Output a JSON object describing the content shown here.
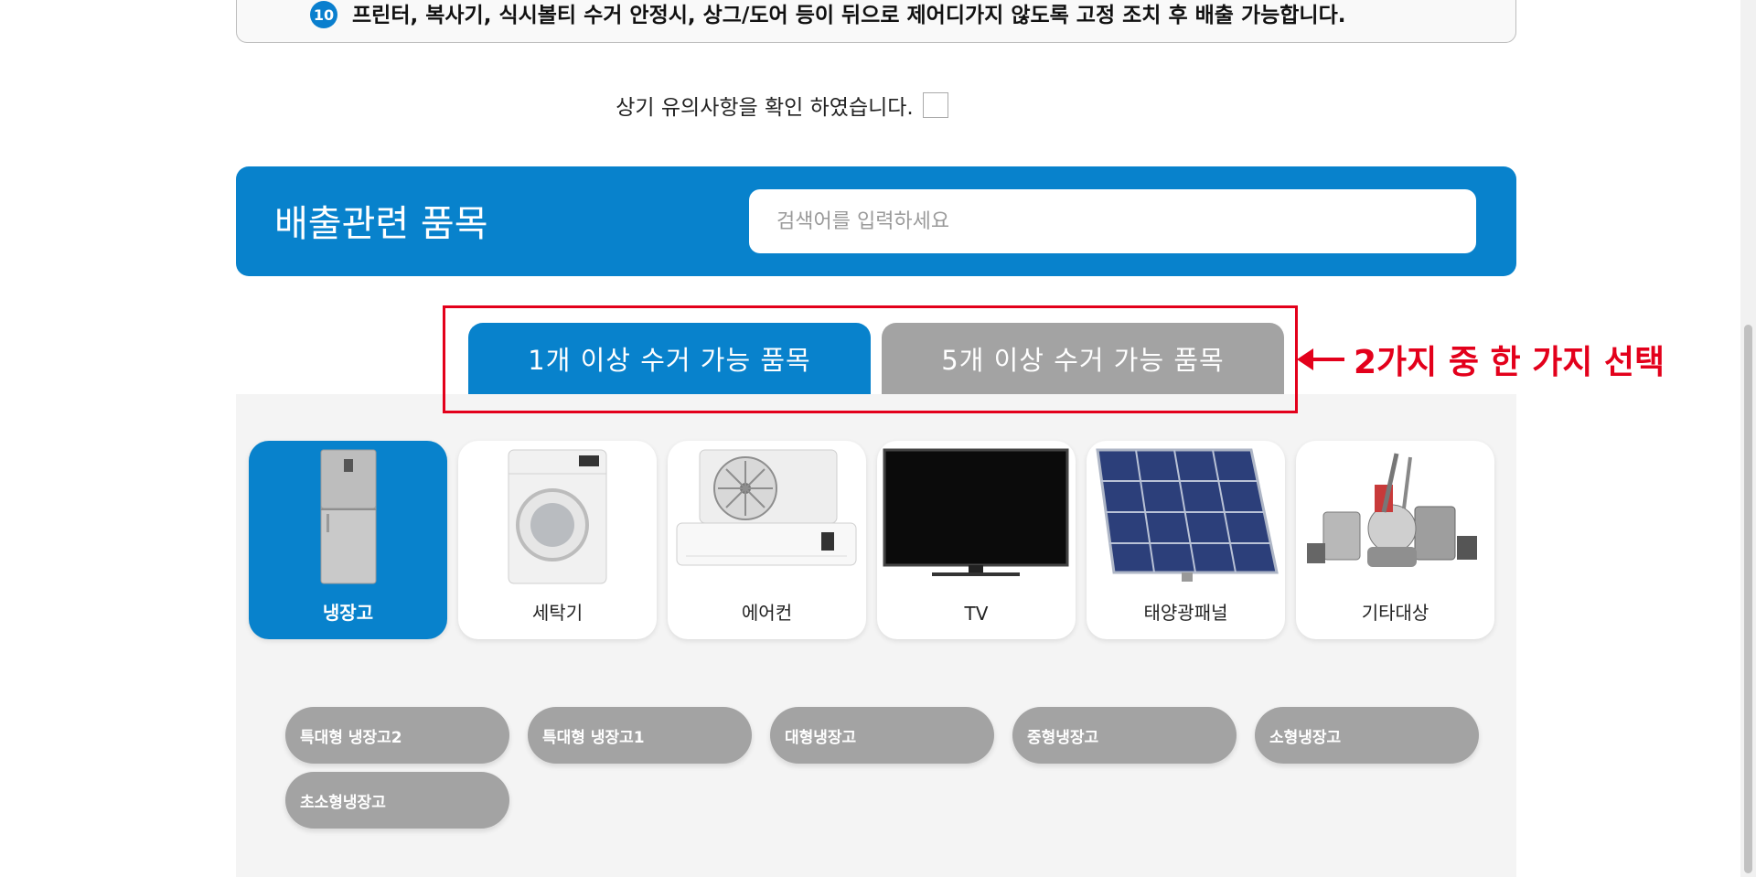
{
  "notice": {
    "number": "10",
    "text": "프린터, 복사기, 식시볼티 수거 안정시, 상그/도어 등이 뒤으로 제어디가지 않도록 고정 조치 후 배출 가능합니다."
  },
  "confirm": {
    "label": "상기 유의사항을 확인 하였습니다."
  },
  "items_header": {
    "title": "배출관련 품목",
    "search_placeholder": "검색어를 입력하세요"
  },
  "tabs": [
    {
      "label": "1개 이상 수거 가능 품목",
      "active": true
    },
    {
      "label": "5개 이상 수거 가능 품목",
      "active": false
    }
  ],
  "annotation": {
    "text": "2가지 중 한 가지 선택",
    "color": "#e3001b"
  },
  "categories": [
    {
      "label": "냉장고",
      "icon": "refrigerator-icon",
      "active": true
    },
    {
      "label": "세탁기",
      "icon": "washing-machine-icon",
      "active": false
    },
    {
      "label": "에어컨",
      "icon": "air-conditioner-icon",
      "active": false
    },
    {
      "label": "TV",
      "icon": "tv-icon",
      "active": false
    },
    {
      "label": "태양광패널",
      "icon": "solar-panel-icon",
      "active": false
    },
    {
      "label": "기타대상",
      "icon": "misc-appliances-icon",
      "active": false
    }
  ],
  "subcategories": [
    {
      "label": "특대형 냉장고2"
    },
    {
      "label": "특대형 냉장고1"
    },
    {
      "label": "대형냉장고"
    },
    {
      "label": "중형냉장고"
    },
    {
      "label": "소형냉장고"
    },
    {
      "label": "초소형냉장고"
    }
  ],
  "colors": {
    "brand_blue": "#0882cc",
    "inactive_gray": "#a3a3a3",
    "highlight_red": "#e3001b"
  }
}
